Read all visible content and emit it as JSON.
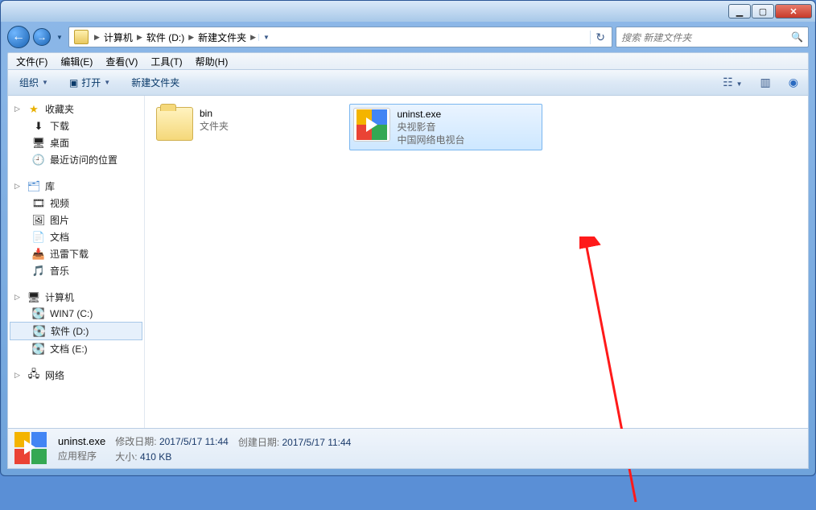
{
  "window": {
    "min_tip": "最小化",
    "max_tip": "还原",
    "close_tip": "关闭"
  },
  "breadcrumb": {
    "items": [
      "计算机",
      "软件 (D:)",
      "新建文件夹"
    ],
    "refresh": "↻"
  },
  "search": {
    "placeholder": "搜索 新建文件夹"
  },
  "menubar": {
    "items": [
      "文件(F)",
      "编辑(E)",
      "查看(V)",
      "工具(T)",
      "帮助(H)"
    ]
  },
  "cmdbar": {
    "organize": "组织",
    "open": "打开",
    "newfolder": "新建文件夹"
  },
  "sidebar": {
    "favorites": {
      "header": "收藏夹",
      "items": [
        {
          "icon": "⬇",
          "label": "下载"
        },
        {
          "icon": "🖥",
          "label": "桌面"
        },
        {
          "icon": "🕘",
          "label": "最近访问的位置"
        }
      ]
    },
    "libraries": {
      "header": "库",
      "items": [
        {
          "icon": "🎞",
          "label": "视频"
        },
        {
          "icon": "🖼",
          "label": "图片"
        },
        {
          "icon": "📄",
          "label": "文档"
        },
        {
          "icon": "📥",
          "label": "迅雷下载"
        },
        {
          "icon": "🎵",
          "label": "音乐"
        }
      ]
    },
    "computer": {
      "header": "计算机",
      "items": [
        {
          "icon": "💽",
          "label": "WIN7 (C:)"
        },
        {
          "icon": "💽",
          "label": "软件 (D:)",
          "selected": true
        },
        {
          "icon": "💽",
          "label": "文档 (E:)"
        }
      ]
    },
    "network": {
      "header": "网络"
    }
  },
  "files": {
    "items": [
      {
        "type": "folder",
        "name": "bin",
        "sub": "文件夹"
      },
      {
        "type": "exe",
        "name": "uninst.exe",
        "sub1": "央视影音",
        "sub2": "中国网络电视台",
        "selected": true
      }
    ]
  },
  "details": {
    "name": "uninst.exe",
    "type": "应用程序",
    "mdate_label": "修改日期:",
    "mdate": "2017/5/17 11:44",
    "cdate_label": "创建日期:",
    "cdate": "2017/5/17 11:44",
    "size_label": "大小:",
    "size": "410 KB"
  }
}
